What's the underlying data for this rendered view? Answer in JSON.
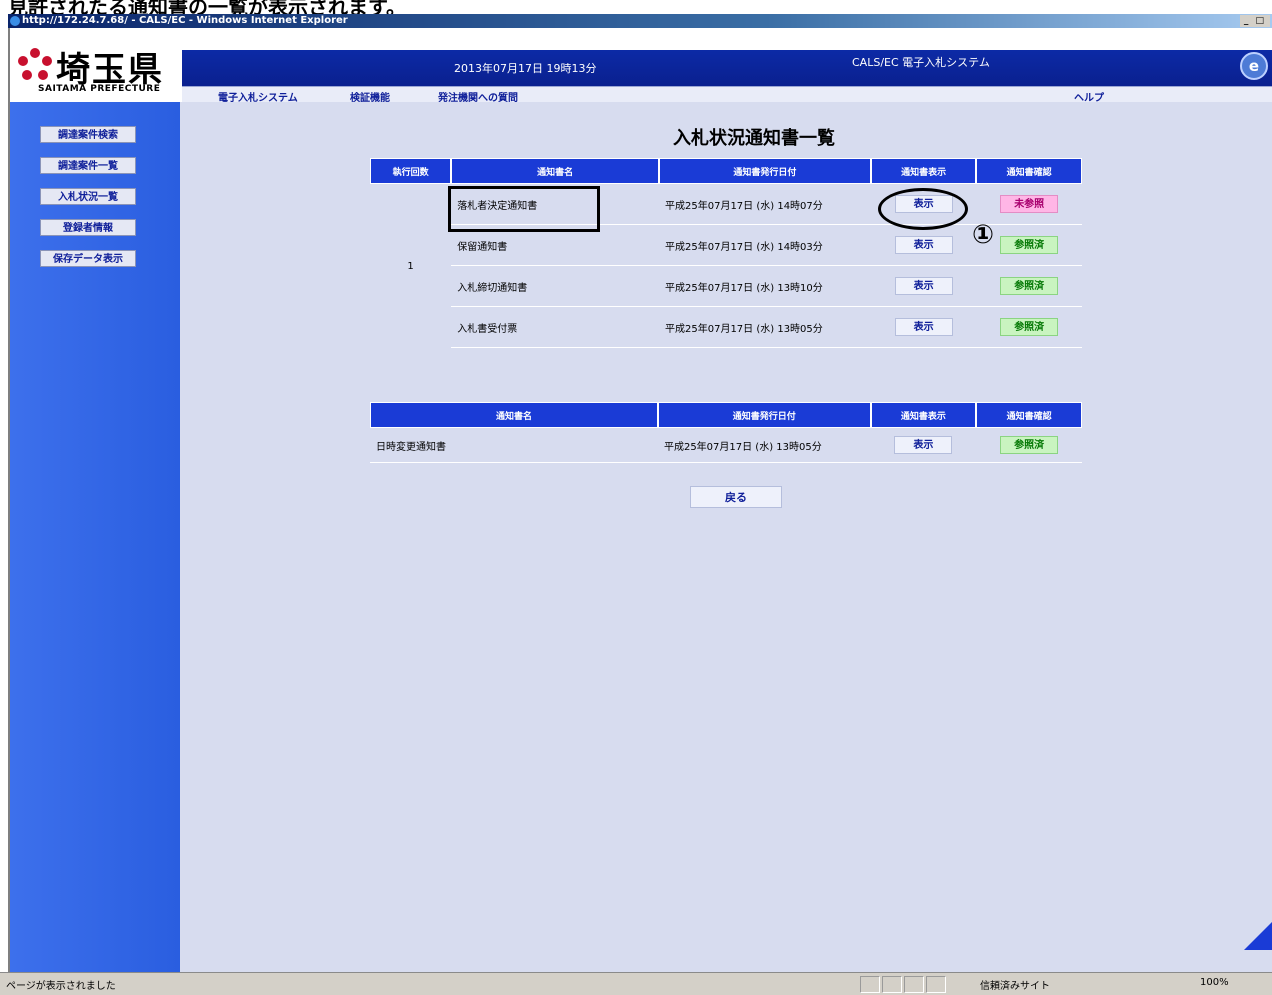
{
  "caption": "見許されたる通知書の一覧が表示されます。",
  "window": {
    "title": "http://172.24.7.68/ - CALS/EC - Windows Internet Explorer",
    "buttons": "_ □ ×"
  },
  "logo": {
    "kanji": "埼玉県",
    "english": "SAITAMA PREFECTURE"
  },
  "banner": {
    "datetime": "2013年07月17日 19時13分",
    "system_name": "CALS/EC 電子入札システム",
    "ie_icon": "e"
  },
  "menubar": {
    "items": [
      "電子入札システム",
      "検証機能",
      "発注機関への質問"
    ],
    "help": "ヘルプ"
  },
  "sidebar": {
    "items": [
      "調達案件検索",
      "調達案件一覧",
      "入札状況一覧",
      "登録者情報",
      "保存データ表示"
    ]
  },
  "page_title": "入札状況通知書一覧",
  "table1": {
    "headers": [
      "執行回数",
      "通知書名",
      "通知書発行日付",
      "通知書表示",
      "通知書確認"
    ],
    "round": "1",
    "rows": [
      {
        "name": "落札者決定通知書",
        "date": "平成25年07月17日 (水) 14時07分",
        "view": "表示",
        "status": "未参照",
        "status_type": "unread"
      },
      {
        "name": "保留通知書",
        "date": "平成25年07月17日 (水) 14時03分",
        "view": "表示",
        "status": "参照済",
        "status_type": "read"
      },
      {
        "name": "入札締切通知書",
        "date": "平成25年07月17日 (水) 13時10分",
        "view": "表示",
        "status": "参照済",
        "status_type": "read"
      },
      {
        "name": "入札書受付票",
        "date": "平成25年07月17日 (水) 13時05分",
        "view": "表示",
        "status": "参照済",
        "status_type": "read"
      }
    ]
  },
  "table2": {
    "headers": [
      "通知書名",
      "通知書発行日付",
      "通知書表示",
      "通知書確認"
    ],
    "rows": [
      {
        "name": "日時変更通知書",
        "date": "平成25年07月17日 (水) 13時05分",
        "view": "表示",
        "status": "参照済",
        "status_type": "read"
      }
    ]
  },
  "back_button": "戻る",
  "annotation": {
    "number": "①"
  },
  "statusbar": {
    "left": "ページが表示されました",
    "zone": "信頼済みサイト",
    "zoom": "100%"
  },
  "colors": {
    "banner": "#0c2aa6",
    "sidebar": "#3d70ec",
    "table_header": "#1a3bd6",
    "content_bg": "#d7dcef",
    "unread": "#ffb6e6",
    "read": "#c9f4c0"
  }
}
